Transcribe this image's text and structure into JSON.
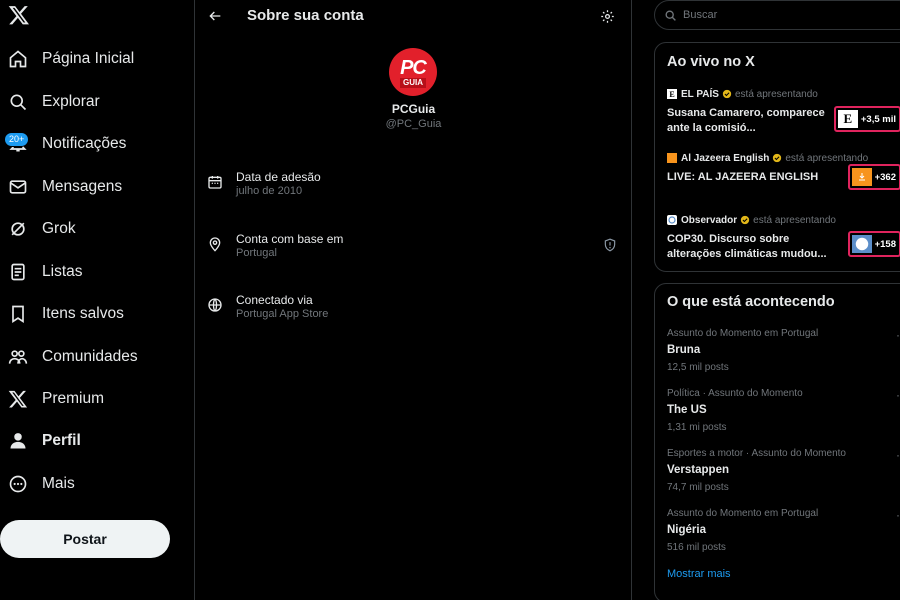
{
  "nav": {
    "items": [
      {
        "label": "Página Inicial",
        "icon": "home-icon"
      },
      {
        "label": "Explorar",
        "icon": "search-icon"
      },
      {
        "label": "Notificações",
        "icon": "bell-icon",
        "badge": "20+"
      },
      {
        "label": "Mensagens",
        "icon": "envelope-icon"
      },
      {
        "label": "Grok",
        "icon": "grok-icon"
      },
      {
        "label": "Listas",
        "icon": "list-icon"
      },
      {
        "label": "Itens salvos",
        "icon": "bookmark-icon"
      },
      {
        "label": "Comunidades",
        "icon": "people-icon"
      },
      {
        "label": "Premium",
        "icon": "x-logo-icon"
      },
      {
        "label": "Perfil",
        "icon": "person-icon"
      },
      {
        "label": "Mais",
        "icon": "more-circle-icon"
      }
    ],
    "post_label": "Postar"
  },
  "header": {
    "title": "Sobre sua conta"
  },
  "account": {
    "avatar_text_main": "PC",
    "avatar_text_sub": "GUIA",
    "name": "PCGuia",
    "handle": "@PC_Guia",
    "rows": [
      {
        "title": "Data de adesão",
        "value": "julho de 2010",
        "icon": "calendar-icon"
      },
      {
        "title": "Conta com base em",
        "value": "Portugal",
        "icon": "location-pin-icon"
      },
      {
        "title": "Conectado via",
        "value": "Portugal App Store",
        "icon": "globe-icon"
      }
    ]
  },
  "search": {
    "placeholder": "Buscar"
  },
  "live": {
    "title": "Ao vivo no X",
    "presenting": "está apresentando",
    "items": [
      {
        "source": "EL PAÍS",
        "headline": "Susana Camarero, comparece ante la comisió...",
        "count": "+3,5 mil",
        "logo": "E"
      },
      {
        "source": "Al Jazeera English",
        "headline": "LIVE: AL JAZEERA ENGLISH",
        "count": "+362",
        "logo": "AJ"
      },
      {
        "source": "Observador",
        "headline": "COP30. Discurso sobre alterações climáticas mudou...",
        "count": "+158",
        "logo": "O"
      }
    ]
  },
  "trends": {
    "title": "O que está acontecendo",
    "items": [
      {
        "category": "Assunto do Momento em Portugal",
        "name": "Bruna",
        "posts": "12,5 mil posts"
      },
      {
        "category": "Política · Assunto do Momento",
        "name": "The US",
        "posts": "1,31 mi posts"
      },
      {
        "category": "Esportes a motor · Assunto do Momento",
        "name": "Verstappen",
        "posts": "74,7 mil posts"
      },
      {
        "category": "Assunto do Momento em Portugal",
        "name": "Nigéria",
        "posts": "516 mil posts"
      }
    ],
    "show_more": "Mostrar mais"
  },
  "colors": {
    "accent": "#1d9bf0",
    "background": "#000000",
    "border": "#2f3336",
    "muted_text": "#71767b",
    "verified_gold": "#e2b719",
    "live_border": "#e0245e"
  }
}
